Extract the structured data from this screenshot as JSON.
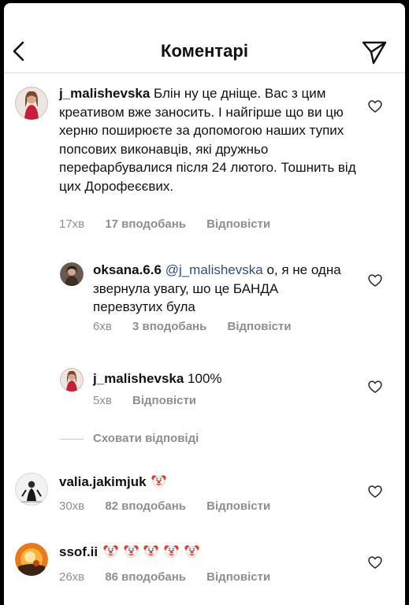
{
  "header": {
    "title": "Коментарі"
  },
  "comments": [
    {
      "username": "j_malishevska",
      "text": "Блін ну це дніще. Вас з цим креативом вже заносить. І найгірше що ви цю херню поширюєте за допомогою наших тупих попсових виконавців, які дружньо перефарбувалися після 24 лютого. Тошнить від цих Дорофеєєвих.",
      "time": "17хв",
      "likes": "17 вподобань",
      "reply": "Відповісти"
    },
    {
      "username": "oksana.6.6",
      "mention": "@j_malishevska",
      "text": "о, я не одна звернула увагу, шо це БАНДА перевзутих була",
      "time": "6хв",
      "likes": "3 вподобань",
      "reply": "Відповісти"
    },
    {
      "username": "j_malishevska",
      "text": "100%",
      "time": "5хв",
      "reply": "Відповісти"
    },
    {
      "username": "valia.jakimjuk",
      "time": "30хв",
      "likes": "82 вподобань",
      "reply": "Відповісти"
    },
    {
      "username": "ssof.ii",
      "time": "26хв",
      "likes": "86 вподобань",
      "reply": "Відповісти"
    }
  ],
  "hide_replies": "Сховати відповіді",
  "icons": {
    "back": "chevron-left-icon",
    "send": "paper-plane-icon",
    "like": "heart-outline-icon",
    "emoji": "clown-face-emoji"
  },
  "colors": {
    "text": "#111111",
    "meta": "#8e8e8e",
    "mention": "#2a4f8a",
    "divider": "#dadada"
  }
}
